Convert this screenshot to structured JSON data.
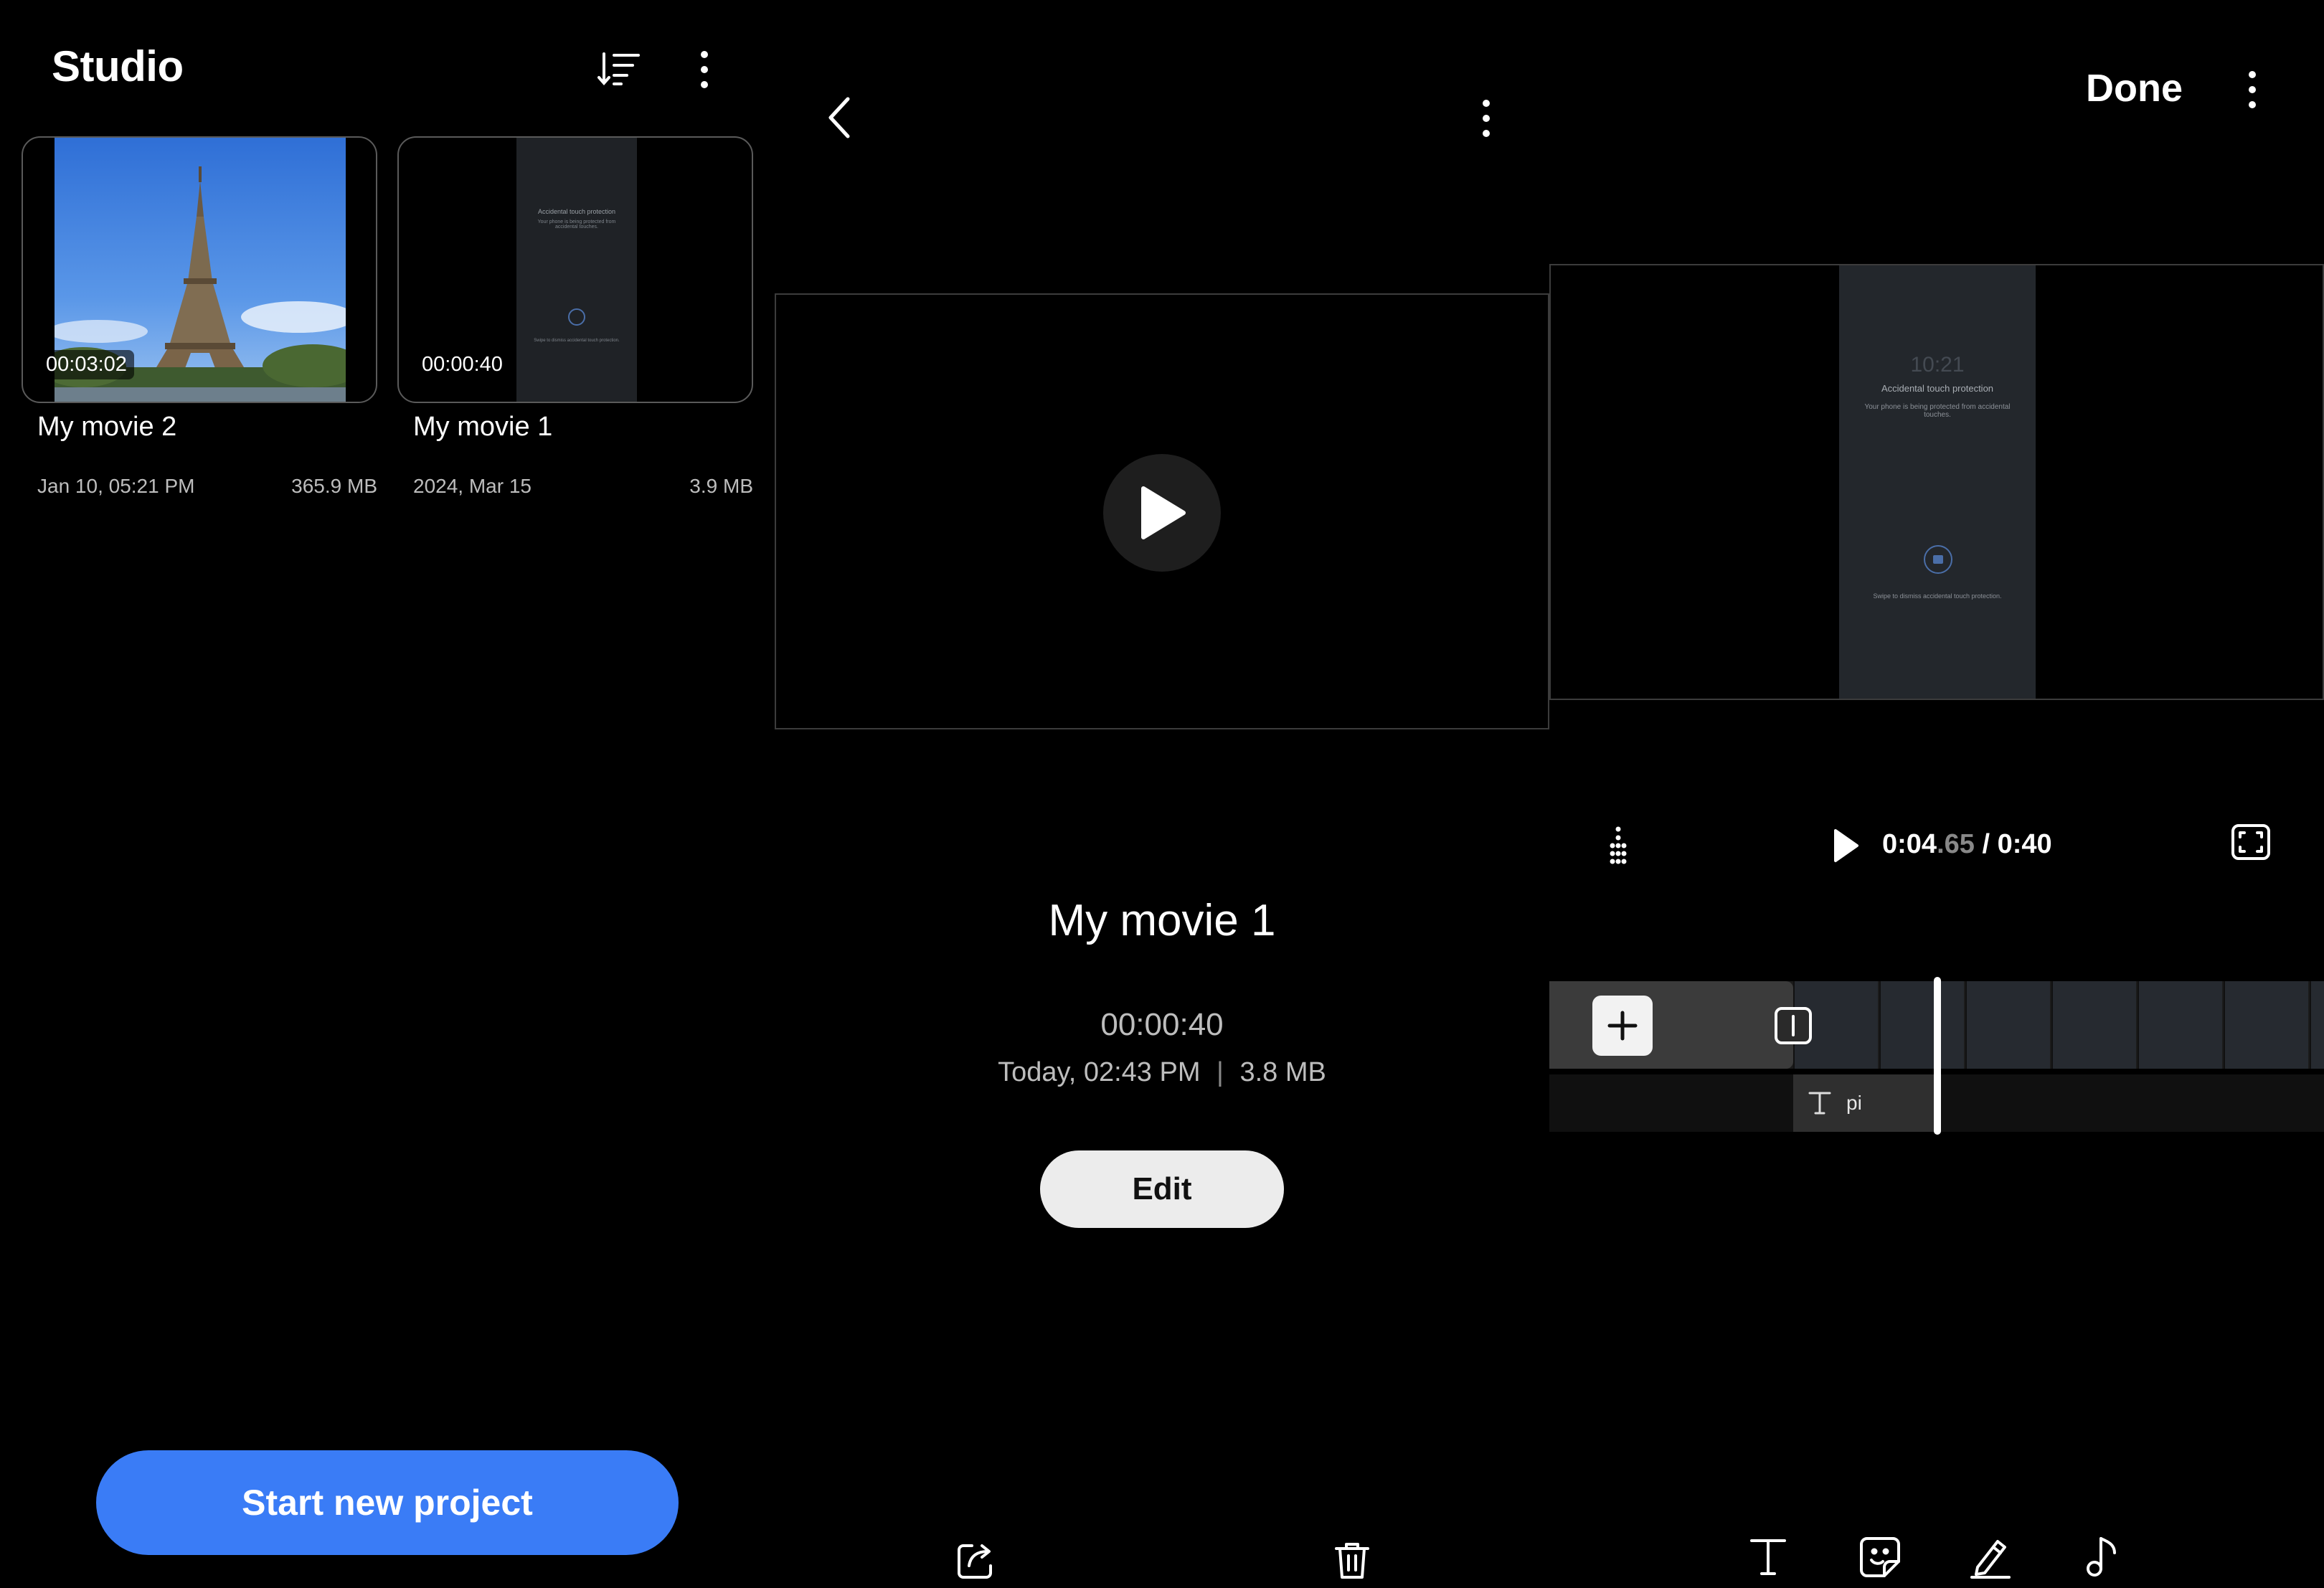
{
  "studio": {
    "title": "Studio",
    "projects": [
      {
        "name": "My movie 2",
        "duration": "00:03:02",
        "date": "Jan 10, 05:21 PM",
        "size": "365.9 MB"
      },
      {
        "name": "My movie 1",
        "duration": "00:00:40",
        "date": "2024, Mar 15",
        "size": "3.9 MB"
      }
    ],
    "start_button": "Start new project",
    "thumb2_lines": {
      "title": "Accidental touch protection",
      "body": "Your phone is being protected from accidental touches.",
      "footer": "Swipe to dismiss accidental touch protection."
    }
  },
  "detail": {
    "movie_name": "My movie 1",
    "duration": "00:00:40",
    "info_date": "Today, 02:43 PM",
    "info_sep": "|",
    "info_size": "3.8 MB",
    "edit_button": "Edit"
  },
  "editor": {
    "done_label": "Done",
    "preview_lines": {
      "clock": "10:21",
      "title": "Accidental touch protection",
      "body": "Your phone is being protected from accidental touches.",
      "footer": "Swipe to dismiss accidental touch protection."
    },
    "time_current_main": "0:04",
    "time_current_frac": ".65",
    "time_sep": " / ",
    "time_total": "0:40",
    "text_clip_label": "pi"
  },
  "colors": {
    "accent": "#3a7cf6",
    "background": "#000000",
    "muted_text": "#bdbdbd"
  },
  "icons": [
    "sort-icon",
    "more-vert-icon",
    "back-arrow-icon",
    "play-icon",
    "aspect-ratio-icon",
    "plus-icon",
    "trim-marker-icon",
    "share-icon",
    "trash-icon",
    "text-icon",
    "sticker-icon",
    "draw-icon",
    "music-icon",
    "lock-icon"
  ]
}
